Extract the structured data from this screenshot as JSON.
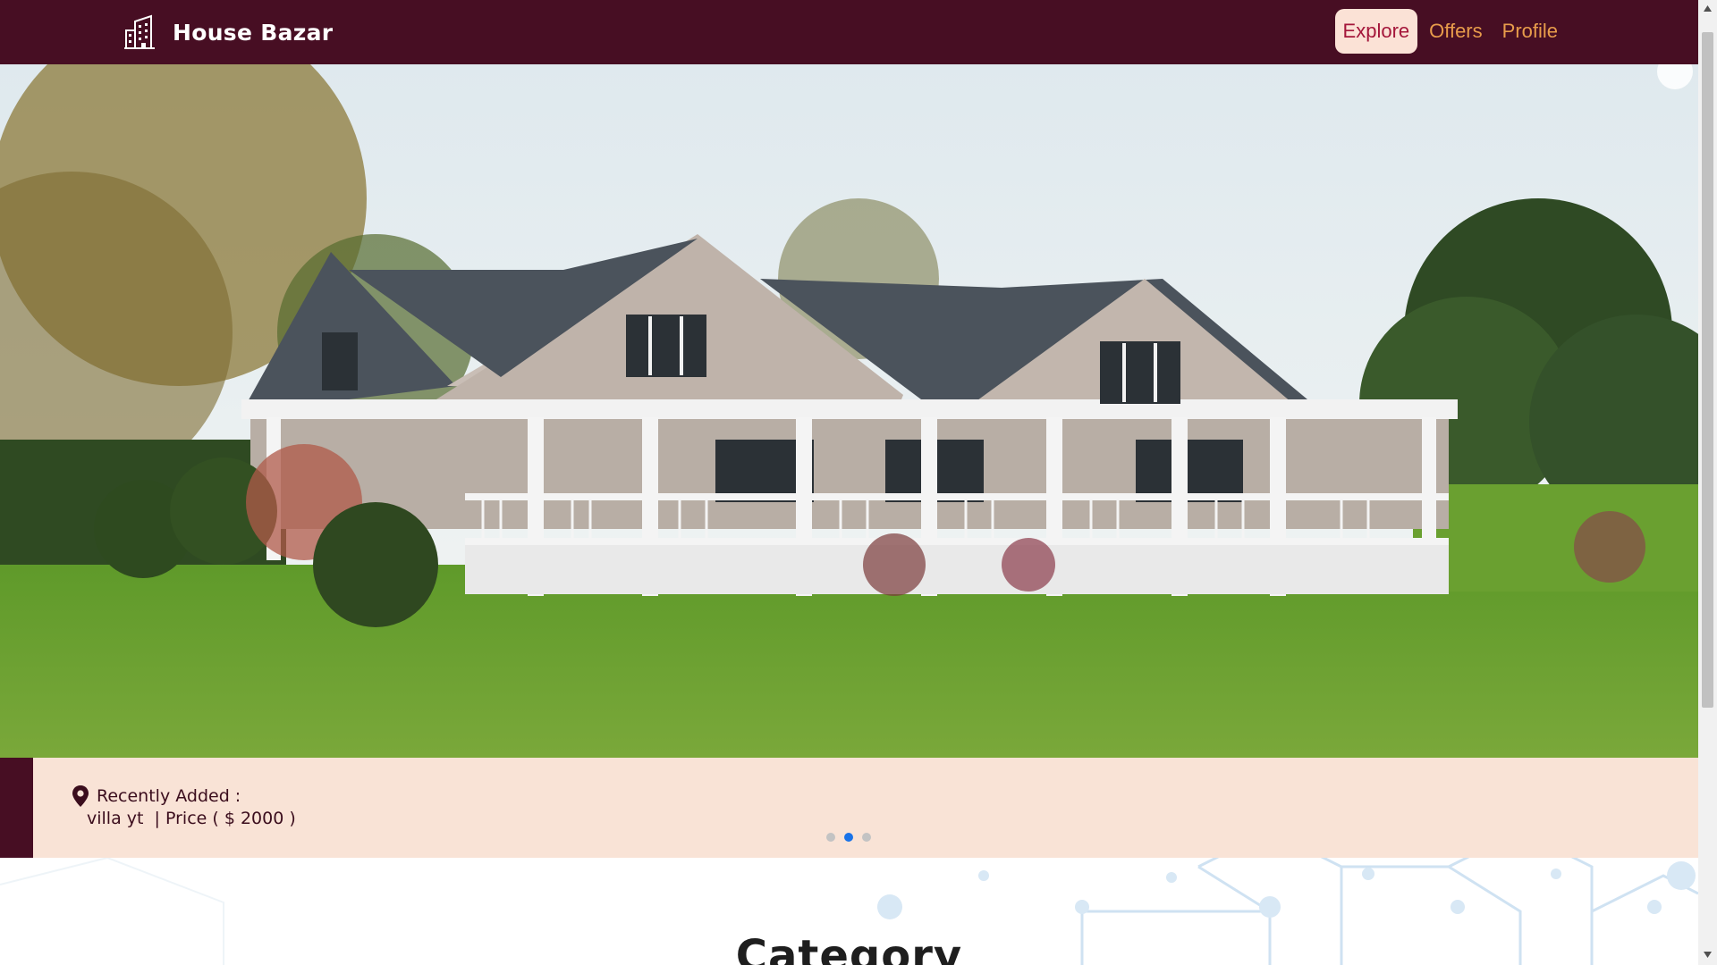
{
  "brand": {
    "name": "House Bazar",
    "icon": "buildings-icon"
  },
  "nav": {
    "links": [
      {
        "label": "Explore",
        "active": true
      },
      {
        "label": "Offers",
        "active": false
      },
      {
        "label": "Profile",
        "active": false
      }
    ]
  },
  "hero": {
    "image": "house-photo",
    "caption": {
      "icon": "location-pin-icon",
      "title": "Recently Added :",
      "detail": "villa yt  | Price ( $ 2000 )"
    },
    "slides": {
      "count": 3,
      "active_index": 1
    }
  },
  "category": {
    "title": "Category"
  },
  "colors": {
    "navbar": "#470e23",
    "nav_link": "#e89c4b",
    "nav_active_bg": "#fbe2d6",
    "nav_active_text": "#a4163a",
    "caption_bg": "#f9e3d6",
    "dot_active": "#1a73e8"
  }
}
